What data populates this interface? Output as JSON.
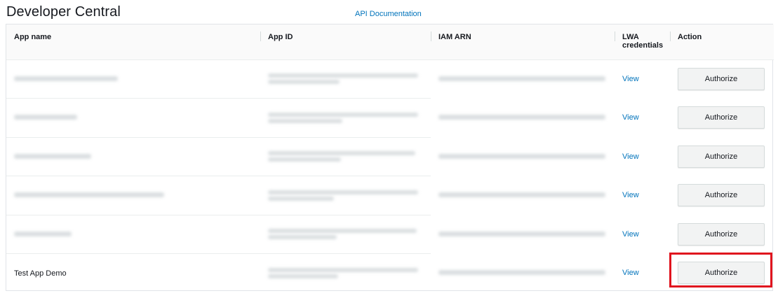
{
  "header": {
    "title": "Developer Central",
    "doc_link": "API Documentation"
  },
  "table": {
    "columns": {
      "app_name": "App name",
      "app_id": "App ID",
      "iam_arn": "IAM ARN",
      "lwa_line1": "LWA",
      "lwa_line2": "credentials",
      "action": "Action"
    },
    "rows": [
      {
        "app_name": "",
        "view": "View",
        "action": "Authorize",
        "redacted": true
      },
      {
        "app_name": "",
        "view": "View",
        "action": "Authorize",
        "redacted": true
      },
      {
        "app_name": "",
        "view": "View",
        "action": "Authorize",
        "redacted": true
      },
      {
        "app_name": "",
        "view": "View",
        "action": "Authorize",
        "redacted": true
      },
      {
        "app_name": "",
        "view": "View",
        "action": "Authorize",
        "redacted": true
      },
      {
        "app_name": "Test App Demo",
        "view": "View",
        "action": "Authorize",
        "redacted": false
      }
    ]
  },
  "colors": {
    "link": "#0073bb",
    "highlight": "#e0141e",
    "button_bg": "#f2f3f3"
  }
}
